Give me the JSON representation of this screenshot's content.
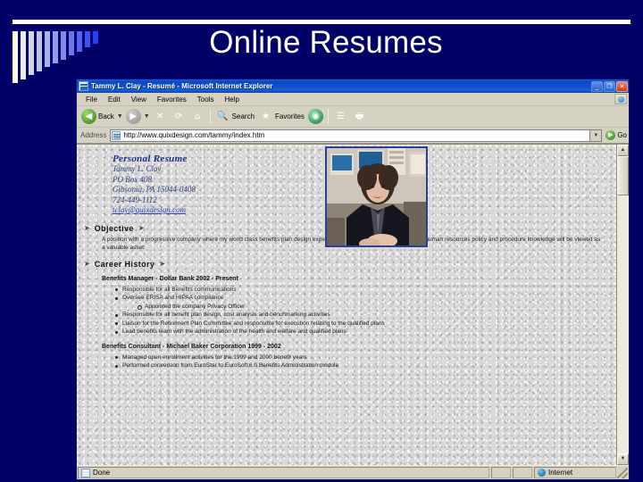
{
  "slide": {
    "title": "Online Resumes",
    "background_color": "#000066",
    "accent_color": "#ffffff"
  },
  "browser": {
    "titlebar": {
      "title": "Tammy L. Clay - Resumé - Microsoft Internet Explorer",
      "minimize": "_",
      "restore": "❐",
      "close": "✕"
    },
    "menu": [
      "File",
      "Edit",
      "View",
      "Favorites",
      "Tools",
      "Help"
    ],
    "toolbar": [
      {
        "name": "back",
        "label": "Back",
        "glyph": "◀",
        "has_dropdown": true
      },
      {
        "name": "forward",
        "label": "",
        "glyph": "▶",
        "has_dropdown": true
      },
      {
        "name": "stop",
        "label": "",
        "glyph": "✕",
        "has_dropdown": false
      },
      {
        "name": "refresh",
        "label": "",
        "glyph": "⟳",
        "has_dropdown": false
      },
      {
        "name": "home",
        "label": "",
        "glyph": "⌂",
        "has_dropdown": false
      },
      {
        "name": "search",
        "label": "Search",
        "glyph": "🔍",
        "has_dropdown": false
      },
      {
        "name": "favorites",
        "label": "Favorites",
        "glyph": "★",
        "has_dropdown": false
      },
      {
        "name": "media",
        "label": "",
        "glyph": "◉",
        "has_dropdown": false
      },
      {
        "name": "history",
        "label": "",
        "glyph": "☰",
        "has_dropdown": false
      },
      {
        "name": "print",
        "label": "",
        "glyph": "🖶",
        "has_dropdown": false
      }
    ],
    "address": {
      "label": "Address",
      "url": "http://www.quixdesign.com/tammy/index.htm",
      "go_label": "Go"
    },
    "status": {
      "left": "Done",
      "zone": "Internet"
    }
  },
  "resume": {
    "heading": "Personal Resume",
    "name": "Tammy L. Clay",
    "address1": "PO Box 408",
    "address2": "Gibsonia, PA  15044-0408",
    "phone": "724-449-1112",
    "email": "tclay@quixdesign.com",
    "photo_alt": "Portrait of Tammy L. Clay at office desk",
    "sections": [
      {
        "name": "Objective",
        "marker_left": "➤",
        "marker_right": "➤",
        "paragraph": "A position with a progressive company where my world class benefits plan design expertise, cost/benefit analysis and general human resources policy and procedure knowledge will be viewed as a valuable asset."
      },
      {
        "name": "Career History",
        "marker_left": "➤",
        "marker_right": "➤",
        "jobs": [
          {
            "title": "Benefits Manager - Dollar Bank   2002 - Present",
            "bullets": [
              {
                "text": "Responsible for all Benefits communications",
                "sub": []
              },
              {
                "text": "Oversee ERISA and HIPAA compliance",
                "sub": [
                  "Appointed the company Privacy Officer"
                ]
              },
              {
                "text": "Responsible for all benefit plan design, cost analysis and benchmarking activities",
                "sub": []
              },
              {
                "text": "Liaison for the Retirement Plan Committee and responsible for execution relating to the qualified plans",
                "sub": []
              },
              {
                "text": "Lead benefits team with the administration of the health and welfare and qualified plans",
                "sub": []
              }
            ]
          },
          {
            "title": "Benefits Consultant - Michael Baker Corporation    1999 - 2002",
            "bullets": [
              {
                "text": "Managed open enrollment activities for the 1999 and 2000 benefit years",
                "sub": []
              },
              {
                "text": "Performed conversion from EuroStar to EuroSoft 6.0 Benefits Administration module",
                "sub": []
              }
            ]
          }
        ]
      }
    ]
  }
}
